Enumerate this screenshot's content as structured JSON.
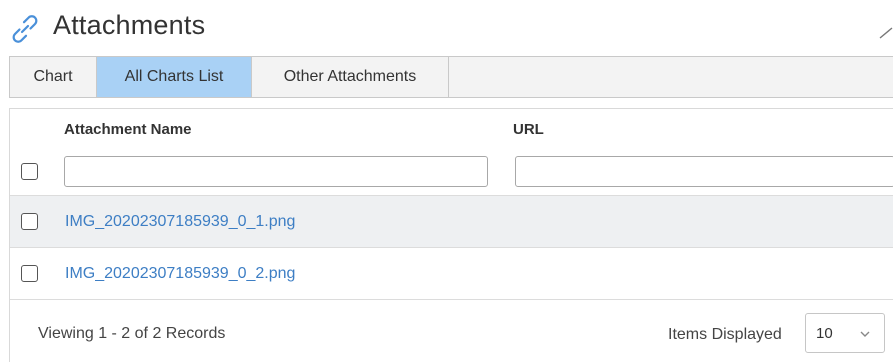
{
  "header": {
    "title": "Attachments",
    "icon": "link-icon"
  },
  "tabs": [
    {
      "label": "Chart",
      "active": false
    },
    {
      "label": "All Charts List",
      "active": true
    },
    {
      "label": "Other Attachments",
      "active": false
    }
  ],
  "grid": {
    "columns": [
      "Attachment Name",
      "URL"
    ],
    "filters": {
      "name_value": "",
      "url_value": ""
    },
    "rows": [
      {
        "name": "IMG_20202307185939_0_1.png",
        "url": ""
      },
      {
        "name": "IMG_20202307185939_0_2.png",
        "url": ""
      }
    ]
  },
  "footer": {
    "records_text": "Viewing 1 - 2 of 2 Records",
    "items_label": "Items Displayed",
    "items_value": "10"
  },
  "colors": {
    "active_tab": "#a9d1f5",
    "link": "#3d7ec4",
    "icon": "#4a90d9"
  }
}
